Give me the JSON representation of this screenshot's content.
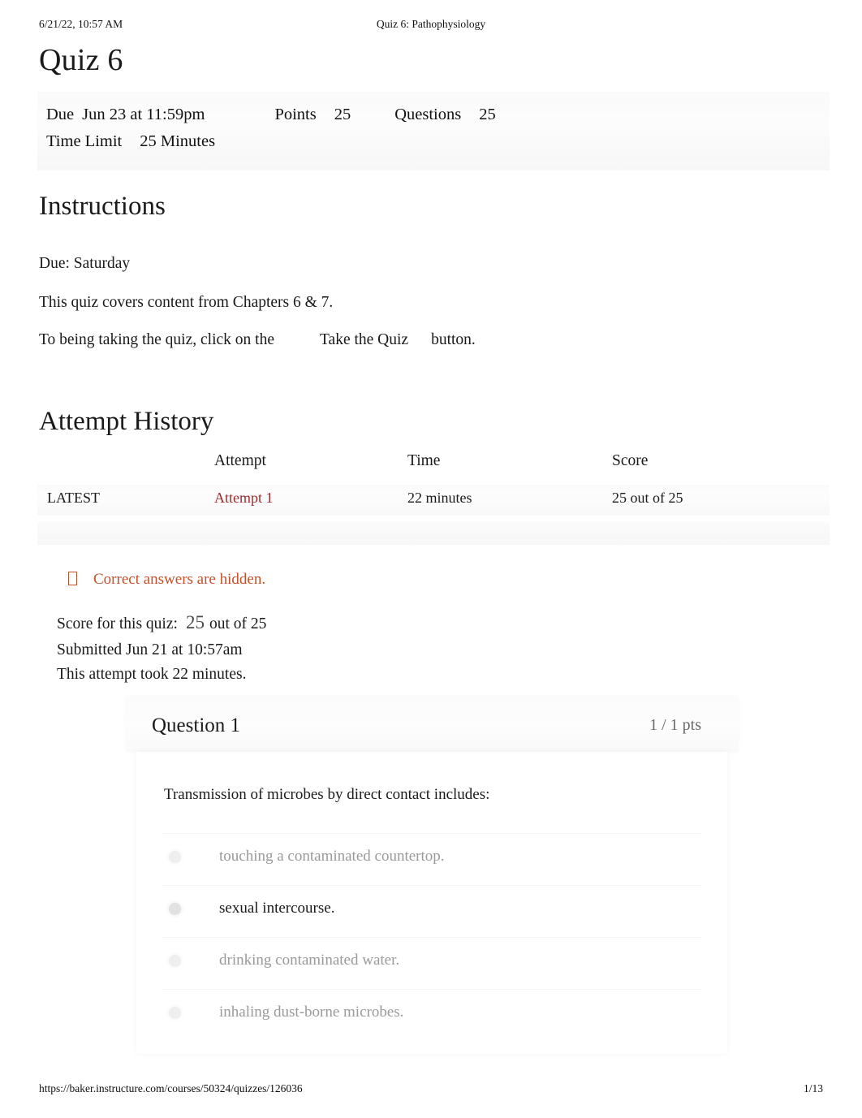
{
  "print_header": {
    "left": "6/21/22, 10:57 AM",
    "center": "Quiz 6: Pathophysiology"
  },
  "page_title": "Quiz 6",
  "quiz_details": {
    "due_label": "Due",
    "due_value": "Jun 23 at 11:59pm",
    "points_label": "Points",
    "points_value": "25",
    "questions_label": "Questions",
    "questions_value": "25",
    "time_limit_label": "Time Limit",
    "time_limit_value": "25 Minutes"
  },
  "instructions": {
    "heading": "Instructions",
    "paragraph_1": "Due: Saturday",
    "paragraph_2": "This quiz covers content from Chapters 6 & 7.",
    "paragraph_3_prefix": "To being taking the quiz, click on the",
    "paragraph_3_button": "Take the Quiz",
    "paragraph_3_suffix": "button."
  },
  "attempt_history": {
    "heading": "Attempt History",
    "columns": [
      "",
      "Attempt",
      "Time",
      "Score"
    ],
    "rows": [
      {
        "marker": "LATEST",
        "attempt": "Attempt 1",
        "time": "22 minutes",
        "score": "25 out of 25"
      }
    ]
  },
  "notice": {
    "icon": "info-icon",
    "text": "Correct answers are hidden."
  },
  "score_summary": {
    "score_label": "Score for this quiz:",
    "score_value": "25",
    "score_suffix": "out of 25",
    "submitted": "Submitted Jun 21 at 10:57am",
    "duration": "This attempt took 22 minutes."
  },
  "question": {
    "name": "Question 1",
    "points": "1 / 1 pts",
    "prompt": "Transmission of microbes by direct contact includes:",
    "answers": [
      {
        "text": "touching a contaminated countertop.",
        "selected": false
      },
      {
        "text": "sexual intercourse.",
        "selected": true
      },
      {
        "text": "drinking contaminated water.",
        "selected": false
      },
      {
        "text": "inhaling dust-borne microbes.",
        "selected": false
      }
    ]
  },
  "print_footer": {
    "url": "https://baker.instructure.com/courses/50324/quizzes/126036",
    "page": "1/13"
  },
  "colors": {
    "link_red": "#9c2b2b",
    "notice_orange": "#c5502a",
    "text": "#1a1a1a",
    "muted": "#9a9a9a",
    "pts_gray": "#6b6b6b"
  }
}
